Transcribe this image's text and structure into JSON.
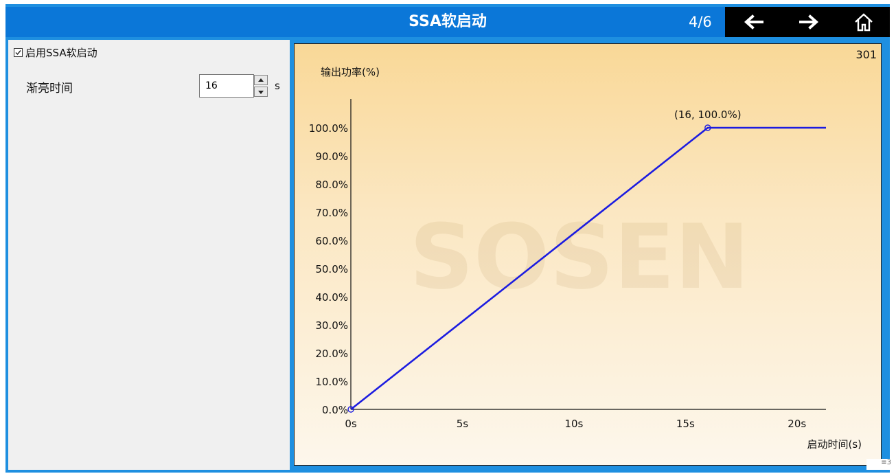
{
  "window": {
    "title": "SSA软启动",
    "page_indicator": "4/6"
  },
  "nav": {
    "back_icon": "arrow-left-icon",
    "forward_icon": "arrow-right-icon",
    "home_icon": "home-icon"
  },
  "settings": {
    "enable_label": "启用SSA软启动",
    "enable_checked": true,
    "ramp_label": "渐亮时间",
    "ramp_value": "16",
    "ramp_unit": "s"
  },
  "panel": {
    "id": "301",
    "watermark": "SOSEN"
  },
  "colors": {
    "titlebar": "#0b77d8",
    "line": "#1c1ce0",
    "chart_top": "#f9d897",
    "chart_bottom": "#fdf7ec"
  },
  "chart_data": {
    "type": "line",
    "ylabel": "输出功率(%)",
    "xlabel": "启动时间(s)",
    "x_ticks": [
      "0s",
      "5s",
      "10s",
      "15s",
      "20s"
    ],
    "y_ticks": [
      "0.0%",
      "10.0%",
      "20.0%",
      "30.0%",
      "40.0%",
      "50.0%",
      "60.0%",
      "70.0%",
      "80.0%",
      "90.0%",
      "100.0%"
    ],
    "xlim": [
      0,
      21.3
    ],
    "ylim": [
      0,
      100
    ],
    "grid": false,
    "series": [
      {
        "x": [
          0,
          16,
          21.3
        ],
        "y": [
          0,
          100,
          100
        ]
      }
    ],
    "markers": [
      {
        "x": 0,
        "y": 0,
        "label": ""
      },
      {
        "x": 16,
        "y": 100,
        "label": "(16, 100.0%)"
      }
    ]
  }
}
